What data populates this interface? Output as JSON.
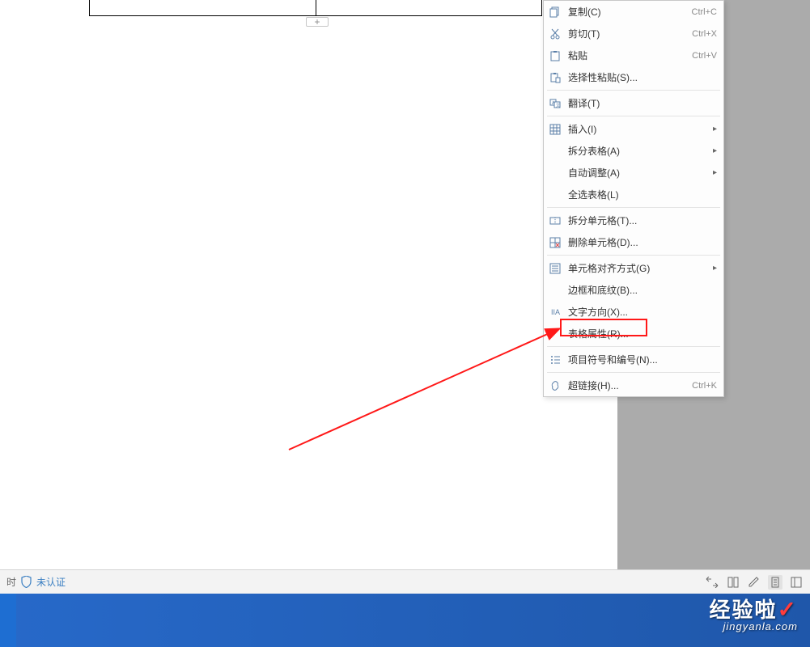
{
  "status": {
    "prefix": "时",
    "verify": "未认证"
  },
  "menu": {
    "copy": "复制(C)",
    "cut": "剪切(T)",
    "paste": "粘贴",
    "paste_special": "选择性粘贴(S)...",
    "translate": "翻译(T)",
    "insert": "插入(I)",
    "split_table": "拆分表格(A)",
    "auto_adjust": "自动调整(A)",
    "select_all_table": "全选表格(L)",
    "split_cell": "拆分单元格(T)...",
    "delete_cell": "删除单元格(D)...",
    "cell_align": "单元格对齐方式(G)",
    "border_shading": "边框和底纹(B)...",
    "text_direction": "文字方向(X)...",
    "table_props": "表格属性(R)...",
    "bullets": "项目符号和编号(N)...",
    "hyperlink": "超链接(H)...",
    "shortcut_copy": "Ctrl+C",
    "shortcut_cut": "Ctrl+X",
    "shortcut_paste": "Ctrl+V",
    "shortcut_hyperlink": "Ctrl+K"
  },
  "table": {
    "add_button": "+"
  },
  "watermark": {
    "title": "经验啦",
    "url": "jingyanla.com"
  }
}
